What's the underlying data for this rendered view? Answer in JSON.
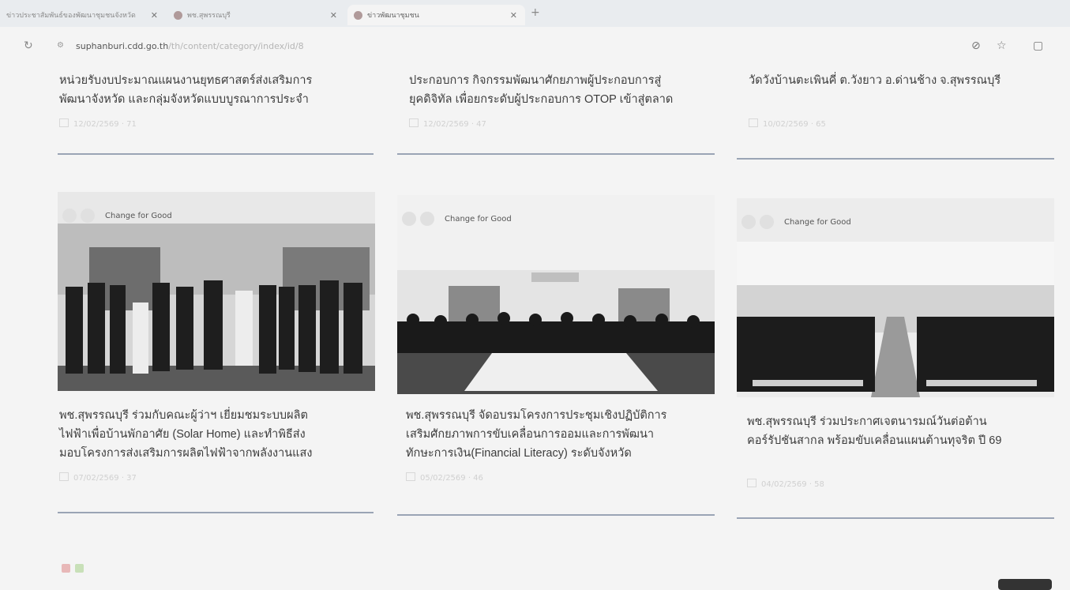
{
  "browser": {
    "tabs": [
      {
        "title": "ข่าวประชาสัมพันธ์ของพัฒนาชุมชนจังหวัด",
        "active": false
      },
      {
        "title": "พช.สุพรรณบุรี",
        "active": false
      },
      {
        "title": "ข่าวพัฒนาชุมชน",
        "active": true
      }
    ],
    "url_domain": "suphanburi.cdd.go.th",
    "url_path": "/th/content/category/index/id/8"
  },
  "cards_top": [
    {
      "line1": "หน่วยรับงบประมาณแผนงานยุทธศาสตร์ส่งเสริมการ",
      "line2": "พัฒนาจังหวัด และกลุ่มจังหวัดแบบบูรณาการประจำ",
      "meta": "12/02/2569 · 71"
    },
    {
      "line1": "ประกอบการ กิจกรรมพัฒนาศักยภาพผู้ประกอบการสู่",
      "line2": "ยุคดิจิทัล เพื่อยกระดับผู้ประกอบการ OTOP เข้าสู่ตลาด",
      "meta": "12/02/2569 · 47"
    },
    {
      "line1": "วัดวังบ้านตะเพินคี่ ต.วังยาว อ.ด่านช้าง จ.สุพรรณบุรี",
      "line2": "",
      "meta": "10/02/2569 · 65"
    }
  ],
  "cards": [
    {
      "title_lines": [
        "พช.สุพรรณบุรี ร่วมกับคณะผู้ว่าฯ เยี่ยมชมระบบผลิต",
        "ไฟฟ้าเพื่อบ้านพักอาศัย (Solar Home) และทำพิธีส่ง",
        "มอบโครงการส่งเสริมการผลิตไฟฟ้าจากพลังงานแสง"
      ],
      "meta": "07/02/2569 · 37",
      "photo_caption": "Change for Good"
    },
    {
      "title_lines": [
        "พช.สุพรรณบุรี จัดอบรมโครงการประชุมเชิงปฏิบัติการ",
        "เสริมศักยภาพการขับเคลื่อนการออมและการพัฒนา",
        "ทักษะการเงิน(Financial Literacy) ระดับจังหวัด"
      ],
      "meta": "05/02/2569 · 46",
      "photo_caption": "Change for Good"
    },
    {
      "title_lines": [
        "พช.สุพรรณบุรี ร่วมประกาศเจตนารมณ์วันต่อต้าน",
        "คอร์รัปชันสากล พร้อมขับเคลื่อนแผนต้านทุจริต ปี 69"
      ],
      "meta": "04/02/2569 · 58",
      "photo_caption": "Change for Good"
    }
  ],
  "colors": {
    "rule": "#9aa4b5",
    "page": "#f4f4f4"
  }
}
